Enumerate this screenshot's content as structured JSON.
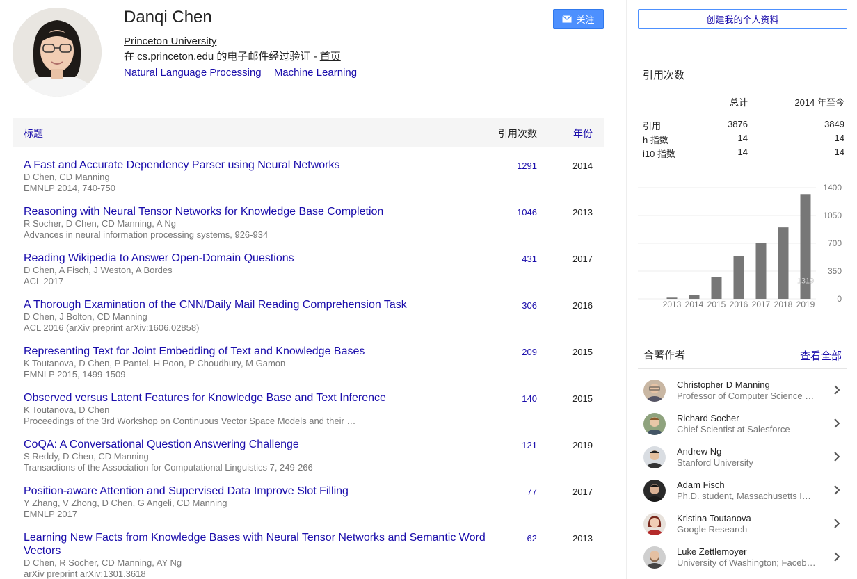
{
  "profile": {
    "name": "Danqi Chen",
    "affiliation": "Princeton University",
    "email_prefix": "在 cs.princeton.edu 的电子邮件经过验证 - ",
    "homepage": "首页",
    "interests": [
      "Natural Language Processing",
      "Machine Learning"
    ],
    "follow_label": "关注"
  },
  "table": {
    "col_title": "标题",
    "col_cites": "引用次数",
    "col_year": "年份"
  },
  "publications": [
    {
      "title": "A Fast and Accurate Dependency Parser using Neural Networks",
      "authors": "D Chen, CD Manning",
      "venue": "EMNLP 2014, 740-750",
      "cites": "1291",
      "year": "2014"
    },
    {
      "title": "Reasoning with Neural Tensor Networks for Knowledge Base Completion",
      "authors": "R Socher, D Chen, CD Manning, A Ng",
      "venue": "Advances in neural information processing systems, 926-934",
      "cites": "1046",
      "year": "2013"
    },
    {
      "title": "Reading Wikipedia to Answer Open-Domain Questions",
      "authors": "D Chen, A Fisch, J Weston, A Bordes",
      "venue": "ACL 2017",
      "cites": "431",
      "year": "2017"
    },
    {
      "title": "A Thorough Examination of the CNN/Daily Mail Reading Comprehension Task",
      "authors": "D Chen, J Bolton, CD Manning",
      "venue": "ACL 2016 (arXiv preprint arXiv:1606.02858)",
      "cites": "306",
      "year": "2016"
    },
    {
      "title": "Representing Text for Joint Embedding of Text and Knowledge Bases",
      "authors": "K Toutanova, D Chen, P Pantel, H Poon, P Choudhury, M Gamon",
      "venue": "EMNLP 2015, 1499-1509",
      "cites": "209",
      "year": "2015"
    },
    {
      "title": "Observed versus Latent Features for Knowledge Base and Text Inference",
      "authors": "K Toutanova, D Chen",
      "venue": "Proceedings of the 3rd Workshop on Continuous Vector Space Models and their …",
      "cites": "140",
      "year": "2015"
    },
    {
      "title": "CoQA: A Conversational Question Answering Challenge",
      "authors": "S Reddy, D Chen, CD Manning",
      "venue": "Transactions of the Association for Computational Linguistics 7, 249-266",
      "cites": "121",
      "year": "2019"
    },
    {
      "title": "Position-aware Attention and Supervised Data Improve Slot Filling",
      "authors": "Y Zhang, V Zhong, D Chen, G Angeli, CD Manning",
      "venue": "EMNLP 2017",
      "cites": "77",
      "year": "2017"
    },
    {
      "title": "Learning New Facts from Knowledge Bases with Neural Tensor Networks and Semantic Word Vectors",
      "authors": "D Chen, R Socher, CD Manning, AY Ng",
      "venue": "arXiv preprint arXiv:1301.3618",
      "cites": "62",
      "year": "2013"
    }
  ],
  "sidebar": {
    "create_profile": "创建我的个人资料",
    "cited_by": "引用次数",
    "stats_header": {
      "all": "总计",
      "since": "2014 年至今"
    },
    "stats": [
      {
        "label": "引用",
        "all": "3876",
        "since": "3849"
      },
      {
        "label": "h 指数",
        "all": "14",
        "since": "14"
      },
      {
        "label": "i10 指数",
        "all": "14",
        "since": "14"
      }
    ],
    "coauthors_title": "合著作者",
    "view_all": "查看全部",
    "coauthors": [
      {
        "name": "Christopher D Manning",
        "affiliation": "Professor of Computer Science …"
      },
      {
        "name": "Richard Socher",
        "affiliation": "Chief Scientist at Salesforce"
      },
      {
        "name": "Andrew Ng",
        "affiliation": "Stanford University"
      },
      {
        "name": "Adam Fisch",
        "affiliation": "Ph.D. student, Massachusetts In…"
      },
      {
        "name": "Kristina Toutanova",
        "affiliation": "Google Research"
      },
      {
        "name": "Luke Zettlemoyer",
        "affiliation": "University of Washington; Faceb…"
      }
    ]
  },
  "chart_data": {
    "type": "bar",
    "categories": [
      "2013",
      "2014",
      "2015",
      "2016",
      "2017",
      "2018",
      "2019"
    ],
    "values": [
      15,
      50,
      280,
      540,
      700,
      900,
      1319
    ],
    "ylim": [
      0,
      1400
    ],
    "yticks": [
      "1400",
      "1050",
      "700",
      "350",
      "0"
    ],
    "hover_label": "1319",
    "bar_color": "#777777",
    "grid": true
  }
}
